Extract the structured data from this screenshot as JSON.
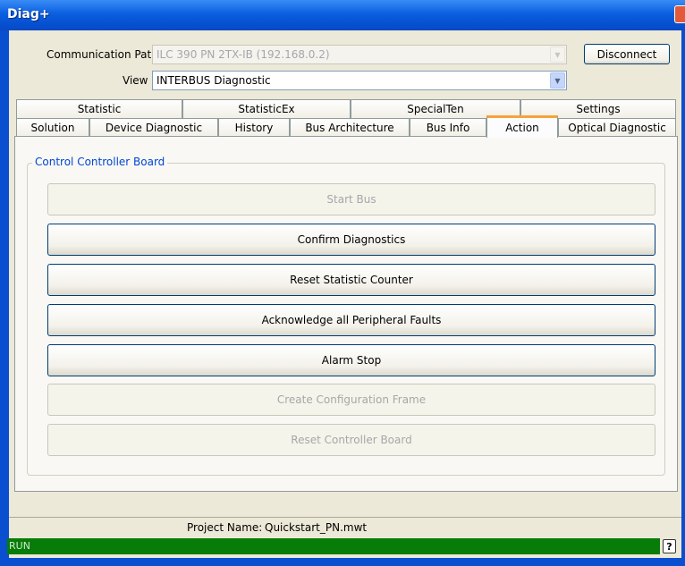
{
  "window": {
    "title": "Diag+"
  },
  "connection": {
    "path_label": "Communication Path",
    "path_value": "ILC 390 PN 2TX-IB (192.168.0.2)",
    "view_label": "View",
    "view_value": "INTERBUS Diagnostic",
    "disconnect_label": "Disconnect"
  },
  "tabs_top": [
    "Statistic",
    "StatisticEx",
    "SpecialTen",
    "Settings"
  ],
  "tabs_bottom": [
    "Solution",
    "Device Diagnostic",
    "History",
    "Bus Architecture",
    "Bus Info",
    "Action",
    "Optical Diagnostic"
  ],
  "active_tab": "Action",
  "group": {
    "title": "Control Controller Board",
    "actions": [
      {
        "label": "Start Bus",
        "enabled": false
      },
      {
        "label": "Confirm Diagnostics",
        "enabled": true
      },
      {
        "label": "Reset Statistic Counter",
        "enabled": true
      },
      {
        "label": "Acknowledge all Peripheral Faults",
        "enabled": true
      },
      {
        "label": "Alarm Stop",
        "enabled": true
      },
      {
        "label": "Create Configuration Frame",
        "enabled": false
      },
      {
        "label": "Reset Controller Board",
        "enabled": false
      }
    ]
  },
  "project": {
    "label": "Project Name:",
    "value": "Quickstart_PN.mwt"
  },
  "status": {
    "text": "RUN",
    "color": "#087c08",
    "help": "?"
  }
}
